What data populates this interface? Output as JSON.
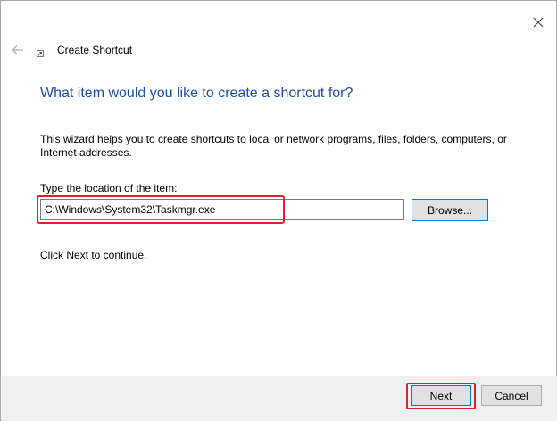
{
  "window": {
    "title": "Create Shortcut",
    "close_icon": "close-icon",
    "back_icon": "back-arrow-icon",
    "app_icon": "shortcut-icon"
  },
  "content": {
    "heading": "What item would you like to create a shortcut for?",
    "description": "This wizard helps you to create shortcuts to local or network programs, files, folders, computers, or Internet addresses.",
    "location_label": "Type the location of the item:",
    "location_value": "C:\\Windows\\System32\\Taskmgr.exe",
    "browse_label": "Browse...",
    "continue_text": "Click Next to continue."
  },
  "footer": {
    "next_label": "Next",
    "cancel_label": "Cancel"
  },
  "colors": {
    "heading": "#1f4ea6",
    "highlight": "#e0232a",
    "focus_border": "#0078d7"
  }
}
